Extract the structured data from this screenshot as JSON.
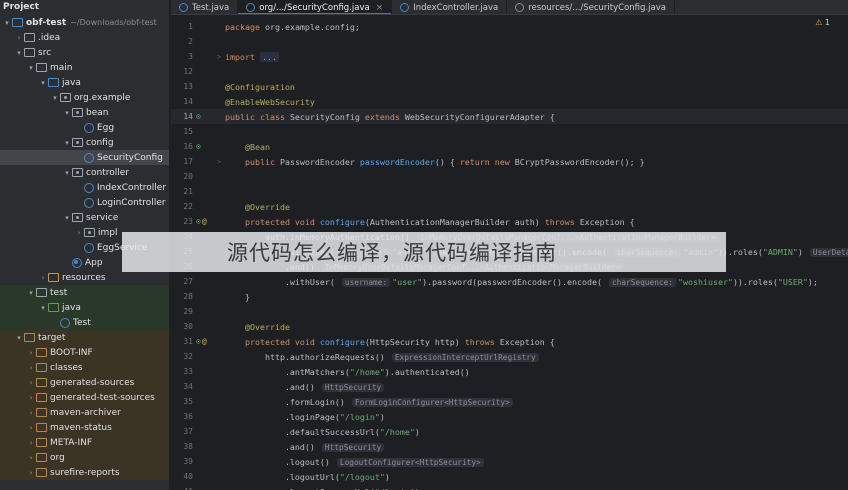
{
  "sidebar": {
    "title": "Project",
    "items": [
      {
        "label": "obf-test",
        "path": "~/Downloads/obf-test",
        "depth": 0,
        "chevron": "v",
        "icon": "module-folder-icon",
        "kind": "module",
        "bold": true
      },
      {
        "label": ".idea",
        "depth": 1,
        "chevron": ">",
        "icon": "folder-icon",
        "kind": "folder"
      },
      {
        "label": "src",
        "depth": 1,
        "chevron": "v",
        "icon": "folder-icon",
        "kind": "folder"
      },
      {
        "label": "main",
        "depth": 2,
        "chevron": "v",
        "icon": "folder-icon",
        "kind": "folder"
      },
      {
        "label": "java",
        "depth": 3,
        "chevron": "v",
        "icon": "source-folder-icon",
        "kind": "src"
      },
      {
        "label": "org.example",
        "depth": 4,
        "chevron": "v",
        "icon": "package-icon",
        "kind": "pkg"
      },
      {
        "label": "bean",
        "depth": 5,
        "chevron": "v",
        "icon": "package-icon",
        "kind": "pkg"
      },
      {
        "label": "Egg",
        "depth": 6,
        "chevron": "",
        "icon": "class-icon",
        "kind": "cls"
      },
      {
        "label": "config",
        "depth": 5,
        "chevron": "v",
        "icon": "package-icon",
        "kind": "pkg"
      },
      {
        "label": "SecurityConfig",
        "depth": 6,
        "chevron": "",
        "icon": "class-icon",
        "kind": "cls",
        "selected": true
      },
      {
        "label": "controller",
        "depth": 5,
        "chevron": "v",
        "icon": "package-icon",
        "kind": "pkg"
      },
      {
        "label": "IndexController",
        "depth": 6,
        "chevron": "",
        "icon": "class-icon",
        "kind": "cls"
      },
      {
        "label": "LoginController",
        "depth": 6,
        "chevron": "",
        "icon": "class-icon",
        "kind": "cls"
      },
      {
        "label": "service",
        "depth": 5,
        "chevron": "v",
        "icon": "package-icon",
        "kind": "pkg"
      },
      {
        "label": "impl",
        "depth": 6,
        "chevron": ">",
        "icon": "package-icon",
        "kind": "pkg"
      },
      {
        "label": "EggService",
        "depth": 6,
        "chevron": "",
        "icon": "class-icon",
        "kind": "cls"
      },
      {
        "label": "App",
        "depth": 5,
        "chevron": "",
        "icon": "application-class-icon",
        "kind": "app"
      },
      {
        "label": "resources",
        "depth": 3,
        "chevron": ">",
        "icon": "resources-folder-icon",
        "kind": "res"
      },
      {
        "label": "test",
        "depth": 2,
        "chevron": "v",
        "icon": "folder-icon",
        "kind": "folder",
        "tint": "test"
      },
      {
        "label": "java",
        "depth": 3,
        "chevron": "v",
        "icon": "test-folder-icon",
        "kind": "test",
        "tint": "test"
      },
      {
        "label": "Test",
        "depth": 4,
        "chevron": "",
        "icon": "class-icon",
        "kind": "cls",
        "tint": "test"
      },
      {
        "label": "target",
        "depth": 1,
        "chevron": "v",
        "icon": "excluded-folder-icon",
        "kind": "ex",
        "tint": "target"
      },
      {
        "label": "BOOT-INF",
        "depth": 2,
        "chevron": ">",
        "icon": "excluded-folder-icon",
        "kind": "ex",
        "tint": "target"
      },
      {
        "label": "classes",
        "depth": 2,
        "chevron": ">",
        "icon": "excluded-folder-icon",
        "kind": "ex",
        "tint": "target"
      },
      {
        "label": "generated-sources",
        "depth": 2,
        "chevron": ">",
        "icon": "excluded-folder-icon",
        "kind": "ex",
        "tint": "target"
      },
      {
        "label": "generated-test-sources",
        "depth": 2,
        "chevron": ">",
        "icon": "excluded-folder-icon",
        "kind": "ex",
        "tint": "target"
      },
      {
        "label": "maven-archiver",
        "depth": 2,
        "chevron": ">",
        "icon": "excluded-folder-icon",
        "kind": "ex",
        "tint": "target"
      },
      {
        "label": "maven-status",
        "depth": 2,
        "chevron": ">",
        "icon": "excluded-folder-icon",
        "kind": "ex",
        "tint": "target"
      },
      {
        "label": "META-INF",
        "depth": 2,
        "chevron": ">",
        "icon": "excluded-folder-icon",
        "kind": "ex",
        "tint": "target"
      },
      {
        "label": "org",
        "depth": 2,
        "chevron": ">",
        "icon": "excluded-folder-icon",
        "kind": "ex",
        "tint": "target"
      },
      {
        "label": "surefire-reports",
        "depth": 2,
        "chevron": ">",
        "icon": "excluded-folder-icon",
        "kind": "ex",
        "tint": "target"
      }
    ]
  },
  "tabs": [
    {
      "label": "Test.java",
      "icon": "class-icon",
      "active": false,
      "closable": false
    },
    {
      "label": "org/.../SecurityConfig.java",
      "icon": "class-icon",
      "active": true,
      "closable": true,
      "close": "×"
    },
    {
      "label": "IndexController.java",
      "icon": "class-icon",
      "active": false,
      "closable": false
    },
    {
      "label": "resources/.../SecurityConfig.java",
      "icon": "readonly-class-icon",
      "active": false,
      "closable": false
    }
  ],
  "editor": {
    "warning_count": "1",
    "warning_icon": "warning-icon",
    "lines": [
      {
        "n": "1",
        "code": [
          {
            "c": "kw",
            "t": "package "
          },
          {
            "t": "org.example.config;"
          }
        ]
      },
      {
        "n": "2",
        "code": []
      },
      {
        "n": "3",
        "fold": ">",
        "code": [
          {
            "c": "kw",
            "t": "import "
          },
          {
            "c": "fb",
            "t": "..."
          }
        ]
      },
      {
        "n": "12",
        "code": []
      },
      {
        "n": "13",
        "code": [
          {
            "c": "an",
            "t": "@Configuration"
          }
        ]
      },
      {
        "n": "14",
        "code": [
          {
            "c": "an",
            "t": "@EnableWebSecurity"
          }
        ]
      },
      {
        "n": "14",
        "current": true,
        "gutter": [
          {
            "c": "gi",
            "t": "⊙"
          }
        ],
        "code": [
          {
            "c": "kw",
            "t": "public class "
          },
          {
            "t": "SecurityConfig "
          },
          {
            "c": "kw",
            "t": "extends "
          },
          {
            "t": "WebSecurityConfigurerAdapter {"
          }
        ]
      },
      {
        "n": "15",
        "code": []
      },
      {
        "n": "16",
        "gutter": [
          {
            "c": "gi",
            "t": "⊙"
          }
        ],
        "code": [
          {
            "t": "    "
          },
          {
            "c": "an",
            "t": "@Bean"
          }
        ]
      },
      {
        "n": "17",
        "fold": ">",
        "code": [
          {
            "t": "    "
          },
          {
            "c": "kw",
            "t": "public "
          },
          {
            "t": "PasswordEncoder "
          },
          {
            "c": "fn",
            "t": "passwordEncoder"
          },
          {
            "t": "() { "
          },
          {
            "c": "kw",
            "t": "return new "
          },
          {
            "t": "BCryptPasswordEncoder(); }"
          }
        ]
      },
      {
        "n": "20",
        "code": []
      },
      {
        "n": "21",
        "code": []
      },
      {
        "n": "22",
        "code": [
          {
            "t": "    "
          },
          {
            "c": "an",
            "t": "@Override"
          }
        ]
      },
      {
        "n": "23",
        "gutter": [
          {
            "c": "gi",
            "t": "⊙"
          },
          {
            "c": "gw",
            "t": "@"
          }
        ],
        "code": [
          {
            "t": "    "
          },
          {
            "c": "kw",
            "t": "protected void "
          },
          {
            "c": "fn",
            "t": "configure"
          },
          {
            "t": "(AuthenticationManagerBuilder auth) "
          },
          {
            "c": "kw",
            "t": "throws "
          },
          {
            "t": "Exception {"
          }
        ]
      },
      {
        "n": "24",
        "code": [
          {
            "t": "        auth.inMemoryAuthentication() "
          },
          {
            "c": "hint",
            "t": "InMemoryUserDetailsManagerConf...<AuthenticationManagerBuilder>"
          }
        ]
      },
      {
        "n": "25",
        "code": [
          {
            "t": "            .withUser( "
          },
          {
            "c": "hint",
            "t": "username:"
          },
          {
            "c": "st",
            "t": "\"admin\""
          },
          {
            "t": ").password(passwordEncoder().encode( "
          },
          {
            "c": "hint",
            "t": "charSequence:"
          },
          {
            "c": "st",
            "t": "\"admin\""
          },
          {
            "t": ")).roles("
          },
          {
            "c": "st",
            "t": "\"ADMIN\""
          },
          {
            "t": ") "
          },
          {
            "c": "hint",
            "t": "UserDeta"
          }
        ]
      },
      {
        "n": "26",
        "code": [
          {
            "t": "            .and() "
          },
          {
            "c": "hint",
            "t": "InMemoryUserDetailsManagerConf...<AuthenticationManagerBuilder>"
          }
        ]
      },
      {
        "n": "27",
        "code": [
          {
            "t": "            .withUser( "
          },
          {
            "c": "hint",
            "t": "username:"
          },
          {
            "c": "st",
            "t": "\"user\""
          },
          {
            "t": ").password(passwordEncoder().encode( "
          },
          {
            "c": "hint",
            "t": "charSequence:"
          },
          {
            "c": "st",
            "t": "\"woshiuser\""
          },
          {
            "t": ")).roles("
          },
          {
            "c": "st",
            "t": "\"USER\""
          },
          {
            "t": ");"
          }
        ]
      },
      {
        "n": "28",
        "code": [
          {
            "t": "    }"
          }
        ]
      },
      {
        "n": "29",
        "code": []
      },
      {
        "n": "30",
        "code": [
          {
            "t": "    "
          },
          {
            "c": "an",
            "t": "@Override"
          }
        ]
      },
      {
        "n": "31",
        "gutter": [
          {
            "c": "gi",
            "t": "⊙"
          },
          {
            "c": "gw",
            "t": "@"
          }
        ],
        "code": [
          {
            "t": "    "
          },
          {
            "c": "kw",
            "t": "protected void "
          },
          {
            "c": "fn",
            "t": "configure"
          },
          {
            "t": "(HttpSecurity http) "
          },
          {
            "c": "kw",
            "t": "throws "
          },
          {
            "t": "Exception {"
          }
        ]
      },
      {
        "n": "32",
        "code": [
          {
            "t": "        http.authorizeRequests() "
          },
          {
            "c": "hint",
            "t": "ExpressionInterceptUrlRegistry"
          }
        ]
      },
      {
        "n": "33",
        "code": [
          {
            "t": "            .antMatchers("
          },
          {
            "c": "st",
            "t": "\"/home\""
          },
          {
            "t": ").authenticated()"
          }
        ]
      },
      {
        "n": "34",
        "code": [
          {
            "t": "            .and() "
          },
          {
            "c": "hint",
            "t": "HttpSecurity"
          }
        ]
      },
      {
        "n": "35",
        "code": [
          {
            "t": "            .formLogin() "
          },
          {
            "c": "hint",
            "t": "FormLoginConfigurer<HttpSecurity>"
          }
        ]
      },
      {
        "n": "36",
        "code": [
          {
            "t": "            .loginPage("
          },
          {
            "c": "st",
            "t": "\"/login\""
          },
          {
            "t": ")"
          }
        ]
      },
      {
        "n": "37",
        "code": [
          {
            "t": "            .defaultSuccessUrl("
          },
          {
            "c": "st",
            "t": "\"/home\""
          },
          {
            "t": ")"
          }
        ]
      },
      {
        "n": "38",
        "code": [
          {
            "t": "            .and() "
          },
          {
            "c": "hint",
            "t": "HttpSecurity"
          }
        ]
      },
      {
        "n": "39",
        "code": [
          {
            "t": "            .logout() "
          },
          {
            "c": "hint",
            "t": "LogoutConfigurer<HttpSecurity>"
          }
        ]
      },
      {
        "n": "40",
        "code": [
          {
            "t": "            .logoutUrl("
          },
          {
            "c": "st",
            "t": "\"/logout\""
          },
          {
            "t": ")"
          }
        ]
      },
      {
        "n": "41",
        "code": [
          {
            "t": "            .logoutSuccessUrl("
          },
          {
            "c": "st",
            "t": "\"/login\""
          },
          {
            "t": ")"
          }
        ]
      }
    ]
  },
  "overlay": {
    "text": "源代码怎么编译，源代码编译指南"
  }
}
